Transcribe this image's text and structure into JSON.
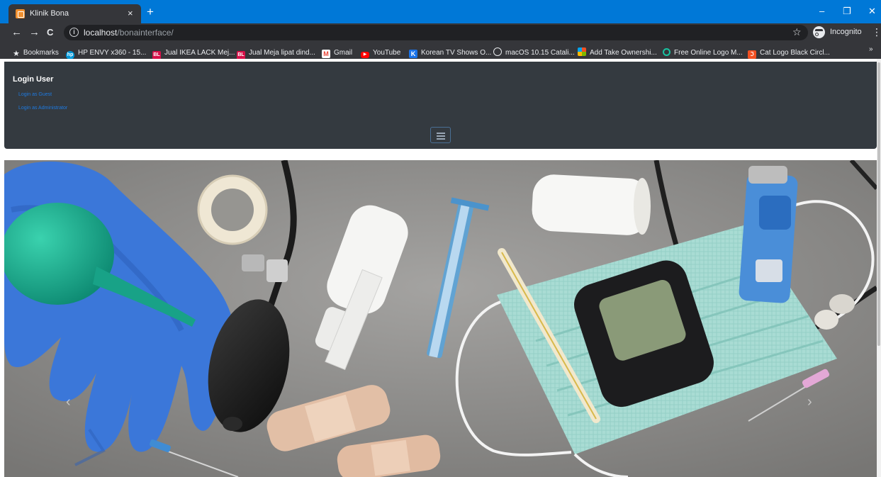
{
  "browser": {
    "tab": {
      "title": "Klinik Bona",
      "close": "×"
    },
    "new_tab": "+",
    "window_controls": {
      "minimize": "–",
      "restore": "❐",
      "close": "✕"
    },
    "nav": {
      "back": "←",
      "forward": "→",
      "reload": "C"
    },
    "address": {
      "host": "localhost",
      "path": "/bonainterface/"
    },
    "profile_label": "Incognito",
    "more_bookmarks": "»",
    "bookmarks": [
      {
        "label": "Bookmarks",
        "icon": "star-icon",
        "color": "#e8eaed"
      },
      {
        "label": "HP ENVY x360 - 15...",
        "icon": "hp-icon",
        "color": "#0096d6"
      },
      {
        "label": "Jual IKEA LACK Mej...",
        "icon": "bl-icon",
        "color": "#d71149"
      },
      {
        "label": "Jual Meja lipat dind...",
        "icon": "bl-icon",
        "color": "#d71149"
      },
      {
        "label": "Gmail",
        "icon": "gmail-icon",
        "color": "#ea4335"
      },
      {
        "label": "YouTube",
        "icon": "youtube-icon",
        "color": "#ff0000"
      },
      {
        "label": "Korean TV Shows O...",
        "icon": "k-icon",
        "color": "#1a73e8"
      },
      {
        "label": "macOS 10.15 Catali...",
        "icon": "clock-icon",
        "color": "#35363a"
      },
      {
        "label": "Add Take Ownershi...",
        "icon": "windows-icon",
        "color": "#f4b400"
      },
      {
        "label": "Free Online Logo M...",
        "icon": "logo-icon",
        "color": "#18c3a1"
      },
      {
        "label": "Cat Logo Black Circl...",
        "icon": "cat-logo-icon",
        "color": "#f25022"
      }
    ]
  },
  "navbar": {
    "heading": "Login User",
    "links": [
      "Login as Guest",
      "Login as Administrator"
    ]
  },
  "carousel": {
    "prev": "‹",
    "next": "›"
  }
}
